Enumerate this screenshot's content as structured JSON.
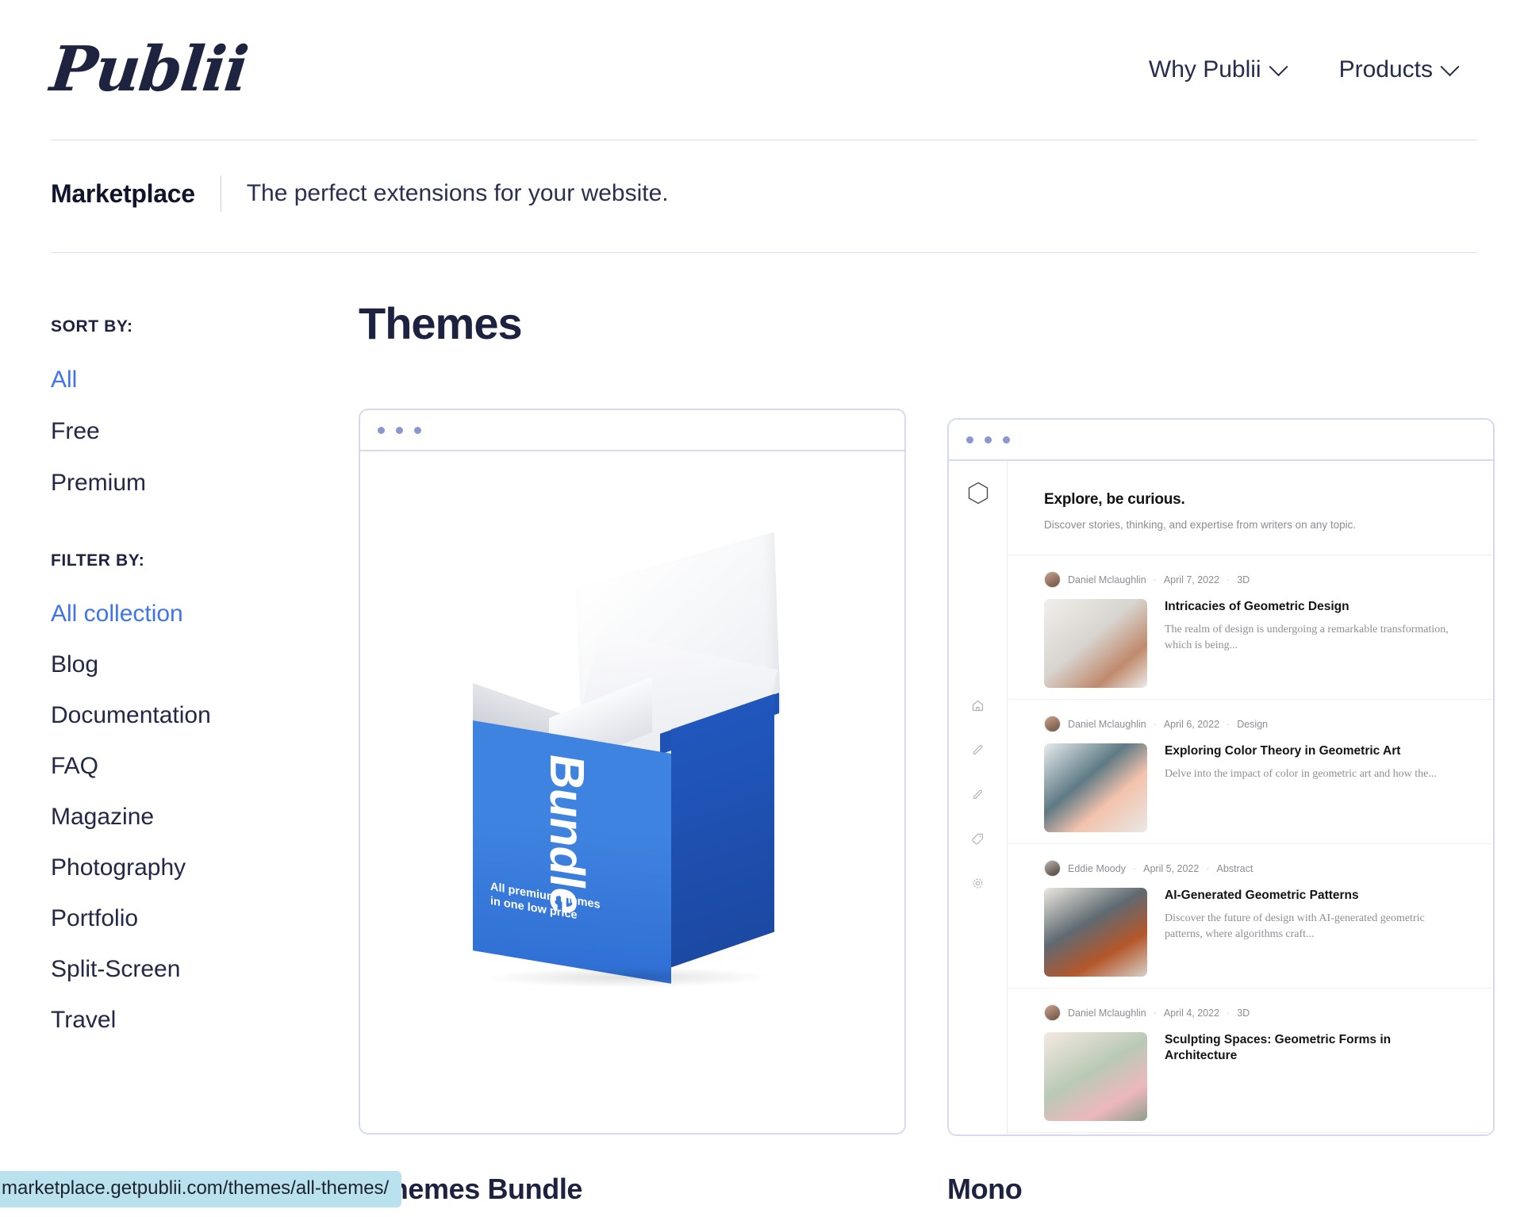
{
  "header": {
    "logo_text": "Publii",
    "nav": [
      {
        "label": "Why Publii",
        "icon": "chevron-down-icon"
      },
      {
        "label": "Products",
        "icon": "chevron-down-icon"
      }
    ]
  },
  "marketplace_bar": {
    "title": "Marketplace",
    "subtitle": "The perfect extensions for your website."
  },
  "sidebar": {
    "sort_by_heading": "SORT BY:",
    "sort_options": [
      {
        "label": "All",
        "active": true
      },
      {
        "label": "Free",
        "active": false
      },
      {
        "label": "Premium",
        "active": false
      }
    ],
    "filter_by_heading": "FILTER BY:",
    "filter_options": [
      {
        "label": "All collection",
        "active": true
      },
      {
        "label": "Blog",
        "active": false
      },
      {
        "label": "Documentation",
        "active": false
      },
      {
        "label": "FAQ",
        "active": false
      },
      {
        "label": "Magazine",
        "active": false
      },
      {
        "label": "Photography",
        "active": false
      },
      {
        "label": "Portfolio",
        "active": false
      },
      {
        "label": "Split-Screen",
        "active": false
      },
      {
        "label": "Travel",
        "active": false
      }
    ]
  },
  "main": {
    "page_title": "Themes",
    "cards": [
      {
        "title": "Publii Themes Bundle",
        "title_visible": "i Themes Bundle",
        "preview_type": "bundle-box",
        "bundle": {
          "word": "Bundle",
          "tagline_line1": "All premium themes",
          "tagline_line2": "in one low price"
        }
      },
      {
        "title": "Mono",
        "preview_type": "mono-blog",
        "mono": {
          "hero_title": "Explore, be curious.",
          "hero_subtitle": "Discover stories, thinking, and expertise from writers on any topic.",
          "rail_icons": [
            "hexagon-logo-icon",
            "home-icon",
            "pencil-icon",
            "pen-icon",
            "tag-icon",
            "gear-icon"
          ],
          "posts": [
            {
              "author": "Daniel Mclaughlin",
              "date": "April 7, 2022",
              "category": "3D",
              "title": "Intricacies of Geometric Design",
              "excerpt": "The realm of design is undergoing a remarkable transformation, which is being..."
            },
            {
              "author": "Daniel Mclaughlin",
              "date": "April 6, 2022",
              "category": "Design",
              "title": "Exploring Color Theory in Geometric Art",
              "excerpt": "Delve into the impact of color in geometric art and how the..."
            },
            {
              "author": "Eddie Moody",
              "date": "April 5, 2022",
              "category": "Abstract",
              "title": "AI-Generated Geometric Patterns",
              "excerpt": "Discover the future of design with AI-generated geometric patterns, where algorithms craft..."
            },
            {
              "author": "Daniel Mclaughlin",
              "date": "April 4, 2022",
              "category": "3D",
              "title": "Sculpting Spaces: Geometric Forms in Architecture",
              "excerpt": ""
            }
          ]
        }
      }
    ]
  },
  "status_bar": {
    "url": "marketplace.getpublii.com/themes/all-themes/"
  },
  "colors": {
    "accent_blue": "#3f73ef",
    "text_dark": "#1c2240",
    "border_light": "#d6daef",
    "status_bg": "#b9e2ee",
    "bundle_blue": "#3f83e0"
  }
}
